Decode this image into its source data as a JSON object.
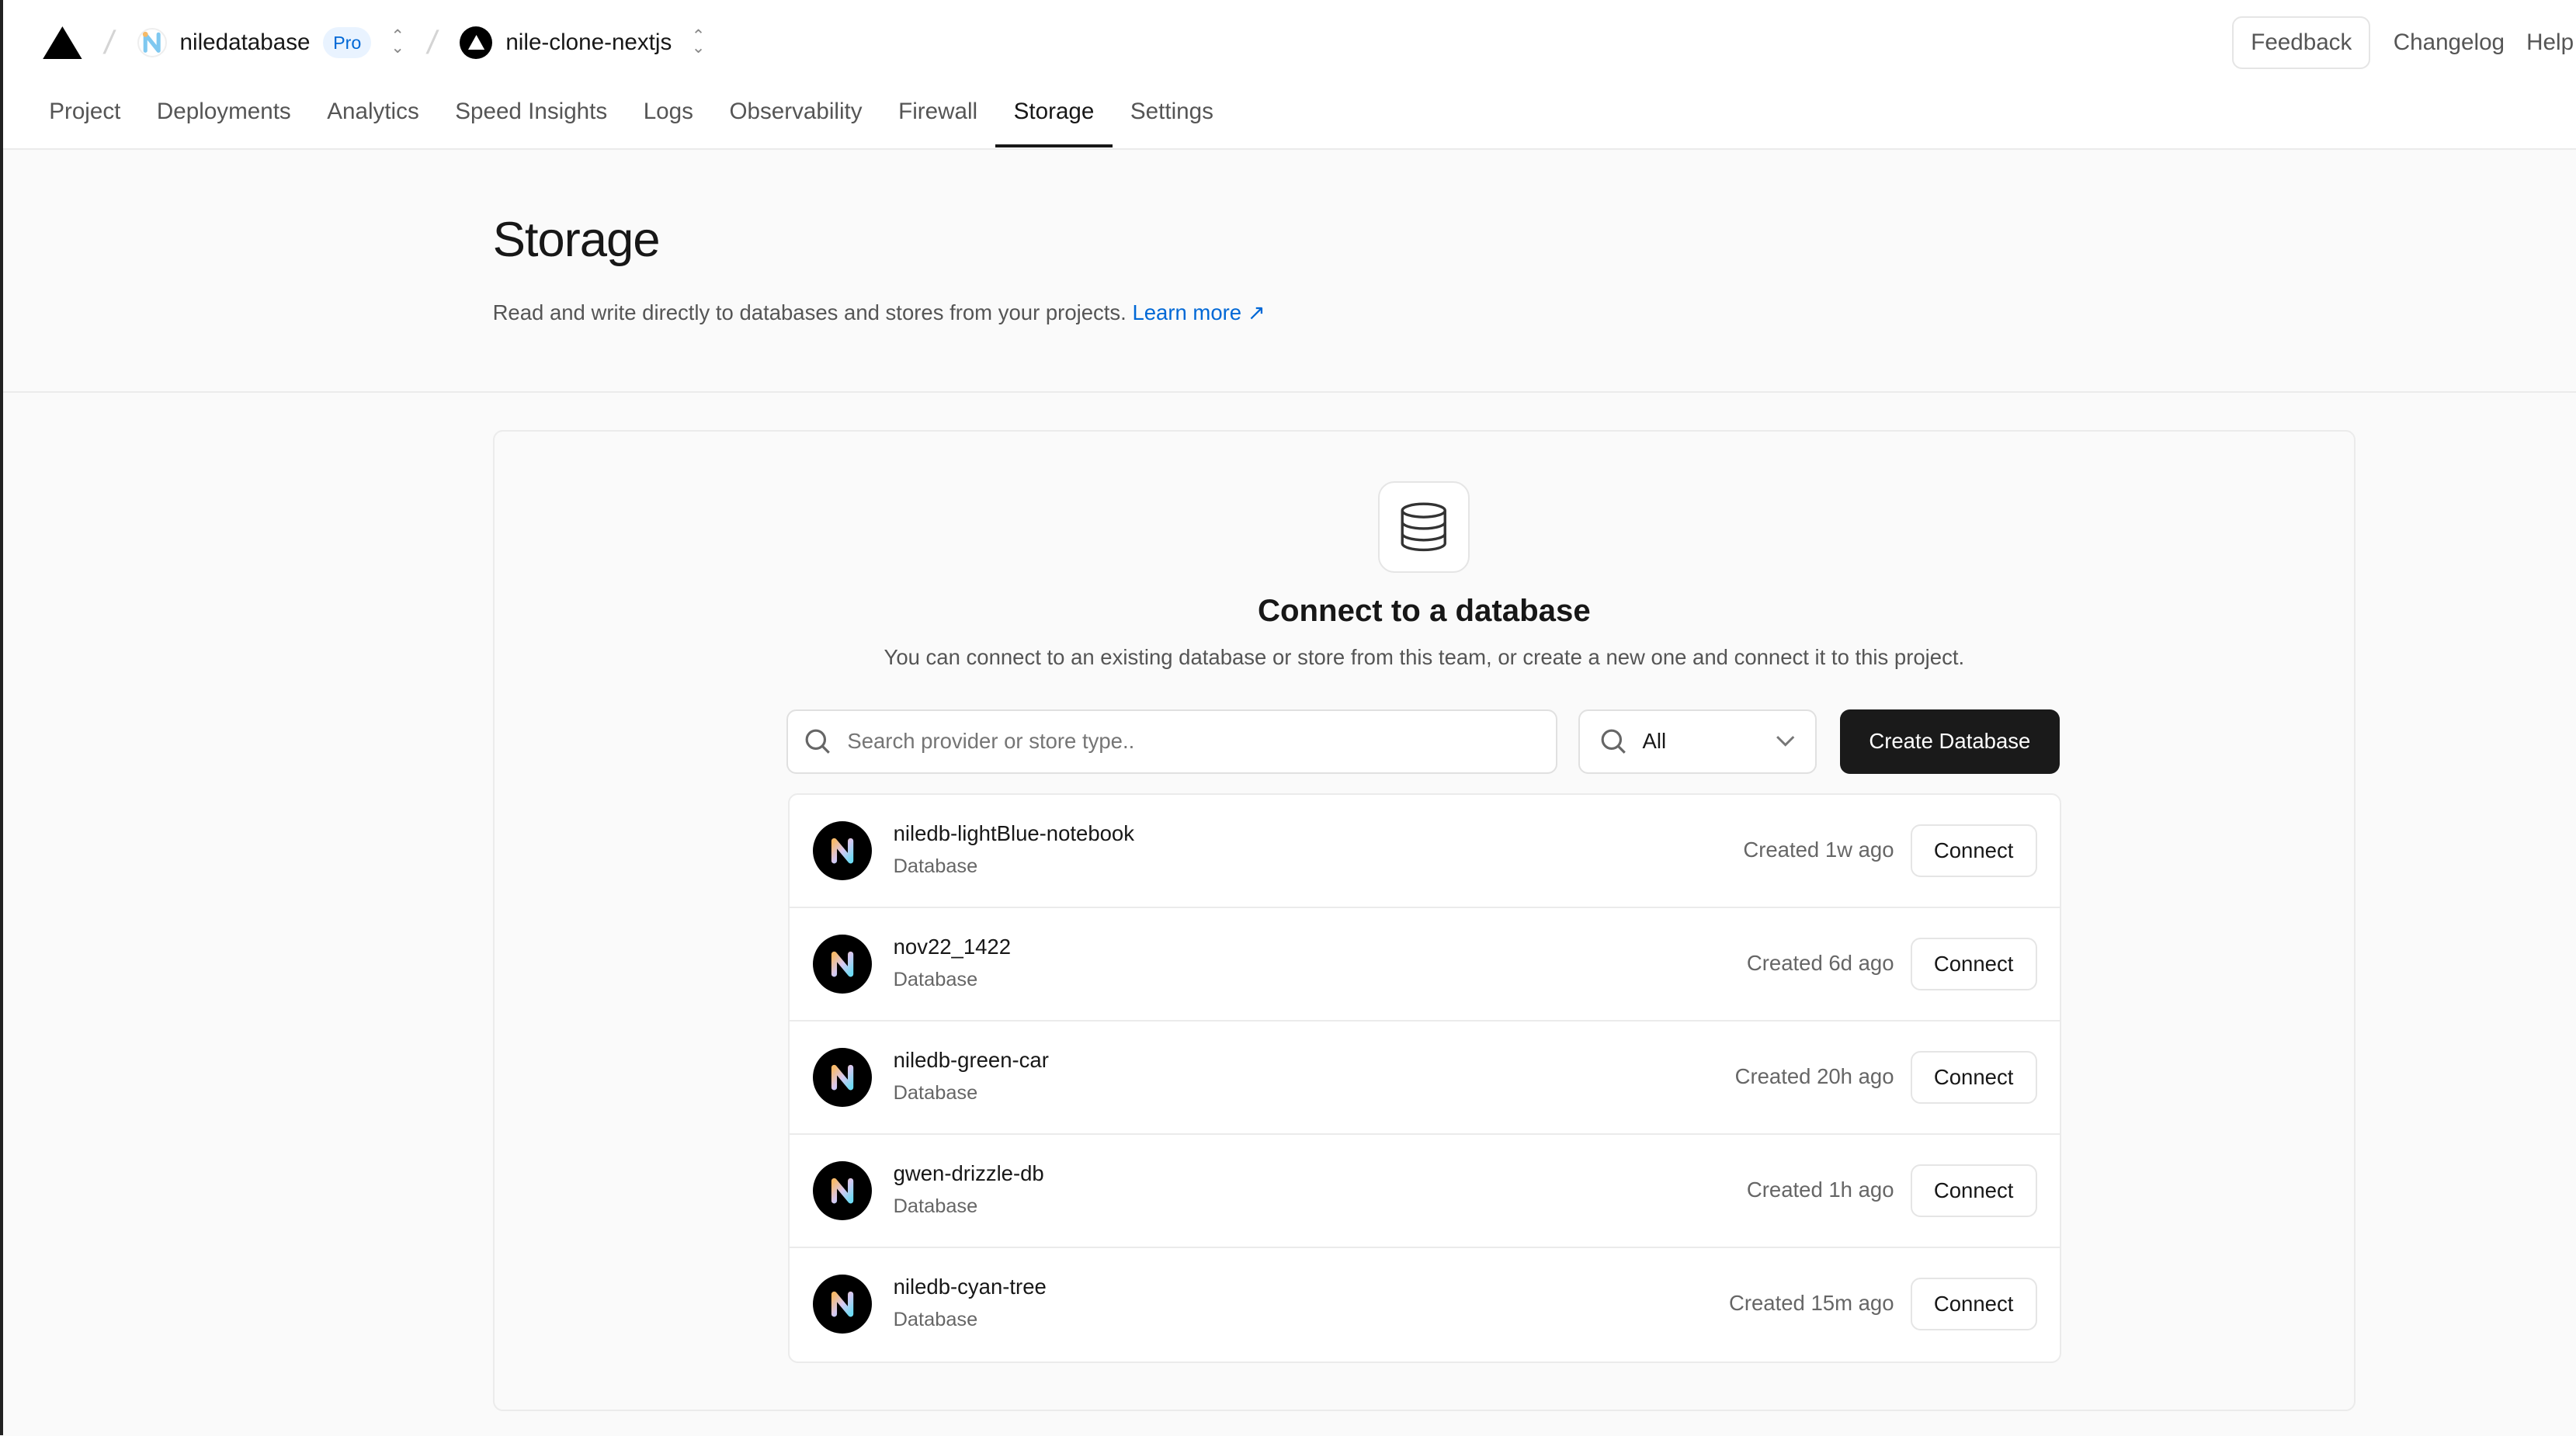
{
  "header": {
    "team": "niledatabase",
    "plan_badge": "Pro",
    "project": "nile-clone-nextjs",
    "feedback": "Feedback",
    "changelog": "Changelog",
    "help": "Help"
  },
  "tabs": [
    "Project",
    "Deployments",
    "Analytics",
    "Speed Insights",
    "Logs",
    "Observability",
    "Firewall",
    "Storage",
    "Settings"
  ],
  "active_tab": "Storage",
  "page": {
    "title": "Storage",
    "description": "Read and write directly to databases and stores from your projects.",
    "learn_more": "Learn more"
  },
  "connect": {
    "heading": "Connect to a database",
    "subtext": "You can connect to an existing database or store from this team, or create a new one and connect it to this project.",
    "search_placeholder": "Search provider or store type..",
    "filter_value": "All",
    "create_button": "Create Database",
    "connect_label": "Connect"
  },
  "databases": [
    {
      "name": "niledb-lightBlue-notebook",
      "type": "Database",
      "created": "Created 1w ago"
    },
    {
      "name": "nov22_1422",
      "type": "Database",
      "created": "Created 6d ago"
    },
    {
      "name": "niledb-green-car",
      "type": "Database",
      "created": "Created 20h ago"
    },
    {
      "name": "gwen-drizzle-db",
      "type": "Database",
      "created": "Created 1h ago"
    },
    {
      "name": "niledb-cyan-tree",
      "type": "Database",
      "created": "Created 15m ago"
    }
  ],
  "colors": {
    "accent": "#0068d6",
    "primary_button": "#1a1a1a"
  }
}
